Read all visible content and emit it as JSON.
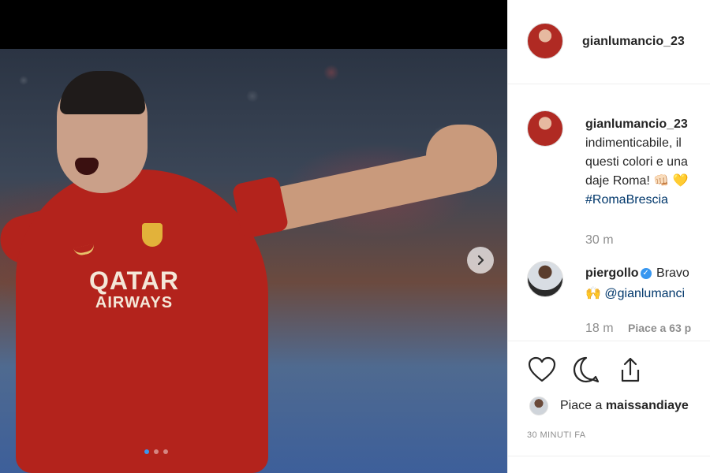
{
  "post": {
    "username": "gianlumancio_23",
    "caption_lines": [
      "indimenticabile, il",
      "questi colori e una",
      "daje Roma! 👊🏻 💛"
    ],
    "hashtag": "#RomaBrescia",
    "caption_time": "30 m",
    "image": {
      "sponsor_line1": "QATAR",
      "sponsor_line2": "AIRWAYS",
      "carousel_count": 3,
      "carousel_active_index": 0
    }
  },
  "comment": {
    "username": "piergollo",
    "text": "Bravo",
    "mention": "@gianlumanci",
    "emoji": "🙌",
    "time": "18 m",
    "likes": "Piace a 63 p"
  },
  "actions": {
    "like_icon": "heart-icon",
    "comment_icon": "comment-icon",
    "share_icon": "share-icon"
  },
  "likes_line": {
    "prefix": "Piace a ",
    "user": "maissandiaye"
  },
  "timestamp": "30 MINUTI FA",
  "colors": {
    "link": "#00376b",
    "verified": "#3897f0",
    "muted": "#8e8e8e"
  }
}
